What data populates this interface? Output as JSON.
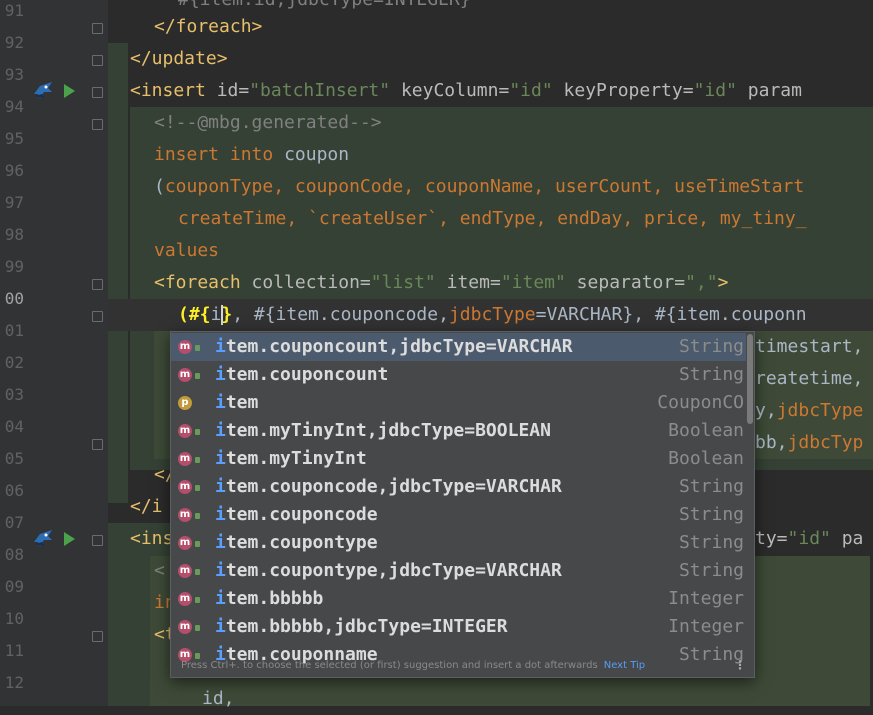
{
  "line_numbers": [
    "91",
    "92",
    "93",
    "94",
    "95",
    "96",
    "97",
    "98",
    "99",
    "00",
    "01",
    "02",
    "03",
    "04",
    "05",
    "06",
    "07",
    "08",
    "09",
    "10",
    "11",
    "12"
  ],
  "code": {
    "r0": {
      "a": "#{item.id,jdbcType=INTEGER}"
    },
    "r1": {
      "a": "</foreach>"
    },
    "r2": {
      "a": "</update>"
    },
    "r3": {
      "open": "<insert",
      "s1": " id=",
      "v1": "\"batchInsert\"",
      "s2": " keyColumn=",
      "v2": "\"id\"",
      "s3": " keyProperty=",
      "v3": "\"id\"",
      "s4": " param"
    },
    "r4": {
      "a": "<!--@mbg.generated-->"
    },
    "r5": {
      "k1": "insert",
      "s": " ",
      "k2": "into",
      "t": " coupon"
    },
    "r6": {
      "p": "(",
      "f": "couponType, couponCode, couponName, userCount, useTimeStart"
    },
    "r7": {
      "f": "createTime, `createUser`, endType, endDay, price, my_tiny_"
    },
    "r8": {
      "k": "values"
    },
    "r9": {
      "open": "<foreach",
      "s1": " collection=",
      "v1": "\"list\"",
      "s2": " item=",
      "v2": "\"item\"",
      "s3": " separator=",
      "v3": "\",\"",
      "close": ">"
    },
    "r10": {
      "a": "(#{",
      "b": "i",
      "c": "}",
      "d": ", #{item.couponcode,",
      "e": "jdbcType",
      "f": "=VARCHAR}, #{item.couponn"
    },
    "r11": {
      "a": "timestart,"
    },
    "r12": {
      "a": "reatetime,"
    },
    "r13": {
      "a": "y,",
      "b": "jdbcType"
    },
    "r14": {
      "a": "bb,",
      "b": "jdbcTyp"
    },
    "r15": {
      "a": "</"
    },
    "r16": {
      "a": "</i"
    },
    "r17": {
      "a": "<ins",
      "b": "ty=",
      "c": "\"id\"",
      "d": " pa"
    },
    "r18": {
      "a": "<"
    },
    "r19": {
      "a": "in"
    },
    "r20": {
      "a": "<t"
    },
    "r21": {
      "a": "id,"
    }
  },
  "completion": {
    "items": [
      {
        "icon": "m",
        "label_match": "i",
        "label_rest": "tem.couponcount,jdbcType=VARCHAR",
        "type": "String"
      },
      {
        "icon": "m",
        "label_match": "i",
        "label_rest": "tem.couponcount",
        "type": "String"
      },
      {
        "icon": "p",
        "label_match": "i",
        "label_rest": "tem",
        "type": "CouponCO"
      },
      {
        "icon": "m",
        "label_match": "i",
        "label_rest": "tem.myTinyInt,jdbcType=BOOLEAN",
        "type": "Boolean"
      },
      {
        "icon": "m",
        "label_match": "i",
        "label_rest": "tem.myTinyInt",
        "type": "Boolean"
      },
      {
        "icon": "m",
        "label_match": "i",
        "label_rest": "tem.couponcode,jdbcType=VARCHAR",
        "type": "String"
      },
      {
        "icon": "m",
        "label_match": "i",
        "label_rest": "tem.couponcode",
        "type": "String"
      },
      {
        "icon": "m",
        "label_match": "i",
        "label_rest": "tem.coupontype",
        "type": "String"
      },
      {
        "icon": "m",
        "label_match": "i",
        "label_rest": "tem.coupontype,jdbcType=VARCHAR",
        "type": "String"
      },
      {
        "icon": "m",
        "label_match": "i",
        "label_rest": "tem.bbbbb",
        "type": "Integer"
      },
      {
        "icon": "m",
        "label_match": "i",
        "label_rest": "tem.bbbbb,jdbcType=INTEGER",
        "type": "Integer"
      },
      {
        "icon": "m",
        "label_match": "i",
        "label_rest": "tem.couponname",
        "type": "String"
      }
    ],
    "footer_hint": "Press Ctrl+. to choose the selected (or first) suggestion and insert a dot afterwards",
    "footer_link": "Next Tip",
    "footer_menu": "⋮"
  }
}
